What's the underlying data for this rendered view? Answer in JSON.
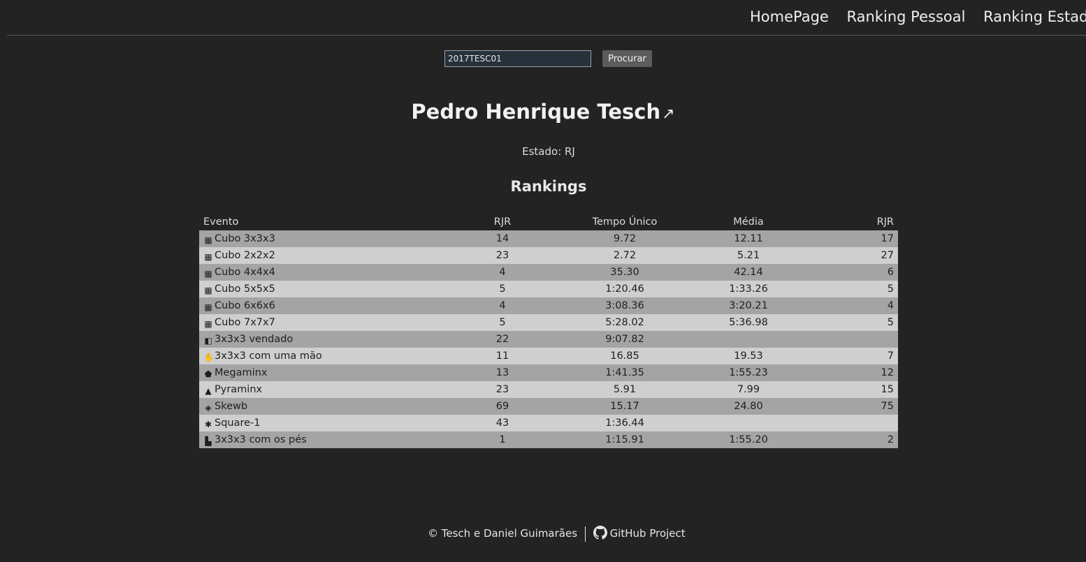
{
  "nav": {
    "items": [
      "HomePage",
      "Ranking Pessoal",
      "Ranking Estadual"
    ]
  },
  "search": {
    "value": "2017TESC01",
    "button_label": "Procurar"
  },
  "profile": {
    "name": "Pedro Henrique Tesch",
    "link_icon": "↗",
    "state_label": "Estado: RJ"
  },
  "rankings": {
    "heading": "Rankings",
    "columns": [
      "Evento",
      "RJR",
      "Tempo Único",
      "Média",
      "RJR"
    ],
    "rows": [
      {
        "event": "Cubo 3x3x3",
        "icon": "cube-3x3-icon",
        "single_rank": "14",
        "single": "9.72",
        "average": "12.11",
        "average_rank": "17"
      },
      {
        "event": "Cubo 2x2x2",
        "icon": "cube-2x2-icon",
        "single_rank": "23",
        "single": "2.72",
        "average": "5.21",
        "average_rank": "27"
      },
      {
        "event": "Cubo 4x4x4",
        "icon": "cube-4x4-icon",
        "single_rank": "4",
        "single": "35.30",
        "average": "42.14",
        "average_rank": "6"
      },
      {
        "event": "Cubo 5x5x5",
        "icon": "cube-5x5-icon",
        "single_rank": "5",
        "single": "1:20.46",
        "average": "1:33.26",
        "average_rank": "5"
      },
      {
        "event": "Cubo 6x6x6",
        "icon": "cube-6x6-icon",
        "single_rank": "4",
        "single": "3:08.36",
        "average": "3:20.21",
        "average_rank": "4"
      },
      {
        "event": "Cubo 7x7x7",
        "icon": "cube-7x7-icon",
        "single_rank": "5",
        "single": "5:28.02",
        "average": "5:36.98",
        "average_rank": "5"
      },
      {
        "event": "3x3x3 vendado",
        "icon": "blindfolded-icon",
        "single_rank": "22",
        "single": "9:07.82",
        "average": "",
        "average_rank": ""
      },
      {
        "event": "3x3x3 com uma mão",
        "icon": "one-hand-icon",
        "single_rank": "11",
        "single": "16.85",
        "average": "19.53",
        "average_rank": "7"
      },
      {
        "event": "Megaminx",
        "icon": "megaminx-icon",
        "single_rank": "13",
        "single": "1:41.35",
        "average": "1:55.23",
        "average_rank": "12"
      },
      {
        "event": "Pyraminx",
        "icon": "pyraminx-icon",
        "single_rank": "23",
        "single": "5.91",
        "average": "7.99",
        "average_rank": "15"
      },
      {
        "event": "Skewb",
        "icon": "skewb-icon",
        "single_rank": "69",
        "single": "15.17",
        "average": "24.80",
        "average_rank": "75"
      },
      {
        "event": "Square-1",
        "icon": "square-1-icon",
        "single_rank": "43",
        "single": "1:36.44",
        "average": "",
        "average_rank": ""
      },
      {
        "event": "3x3x3 com os pés",
        "icon": "feet-icon",
        "single_rank": "1",
        "single": "1:15.91",
        "average": "1:55.20",
        "average_rank": "2"
      }
    ]
  },
  "footer": {
    "credit": "© Tesch e Daniel Guimarães",
    "github_label": "GitHub Project"
  }
}
